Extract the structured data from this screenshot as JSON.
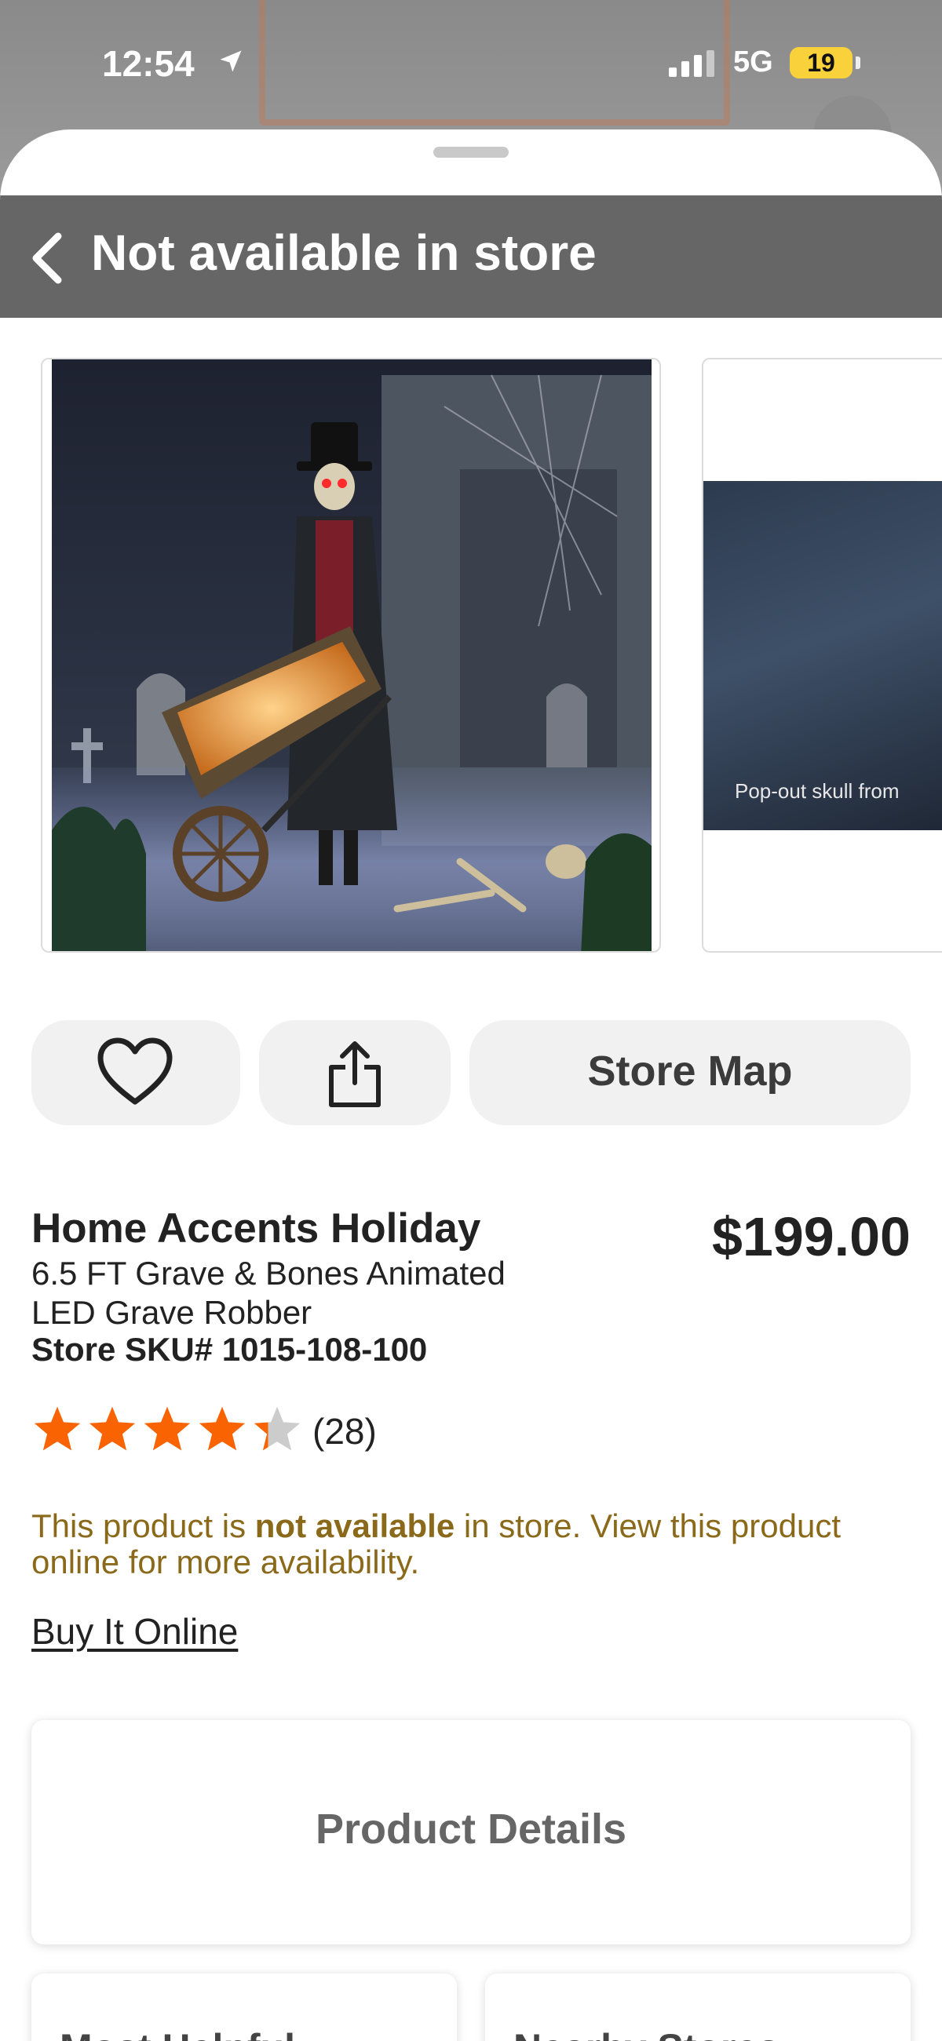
{
  "status_bar": {
    "time": "12:54",
    "network": "5G",
    "battery": "19"
  },
  "header": {
    "title": "Not available in store"
  },
  "gallery": {
    "video_caption": "Pop-out skull from"
  },
  "actions": {
    "store_map_label": "Store Map"
  },
  "product": {
    "brand": "Home Accents Holiday",
    "name": "6.5 FT Grave & Bones Animated LED Grave Robber",
    "sku": "Store SKU# 1015-108-100",
    "price": "$199.00",
    "rating": 4.5,
    "review_count": "(28)"
  },
  "availability": {
    "text_before": "This product is ",
    "text_bold": "not available",
    "text_after": " in store. View this product online for more availability.",
    "buy_online_label": "Buy It Online"
  },
  "details": {
    "label": "Product Details"
  },
  "bottom_cards": {
    "left_label": "Most Helpful",
    "right_label": "Nearby Stores"
  },
  "colors": {
    "header_bg": "#666666",
    "star_filled": "#f96302",
    "star_empty": "#cccccc",
    "availability_text": "#8a6a1a",
    "battery": "#f8d13b"
  }
}
